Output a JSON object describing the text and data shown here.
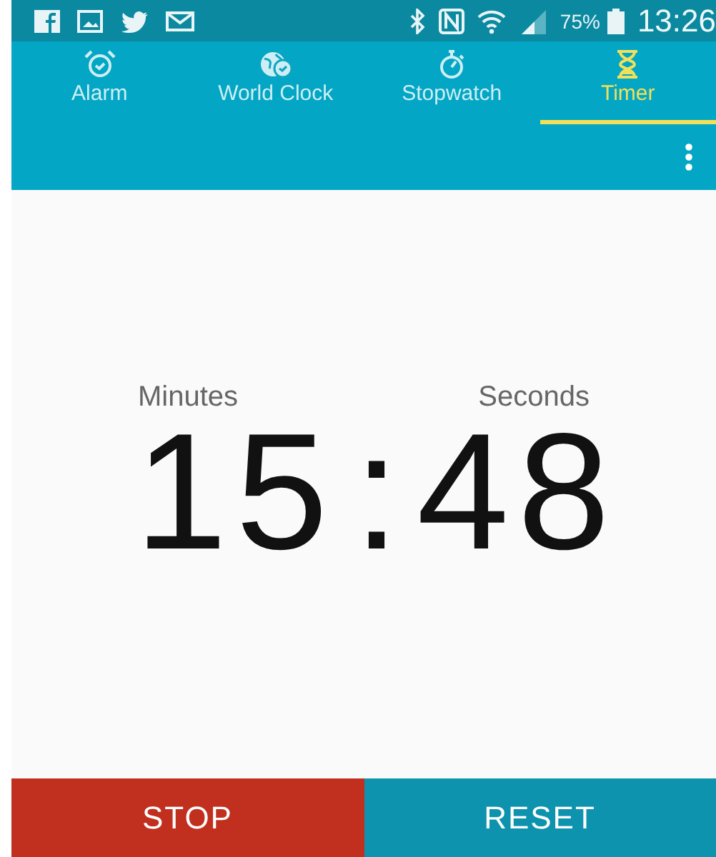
{
  "status_bar": {
    "battery": "75%",
    "time": "13:26"
  },
  "tabs": [
    {
      "label": "Alarm",
      "kind": "alarm",
      "selected": false
    },
    {
      "label": "World Clock",
      "kind": "globe",
      "selected": false
    },
    {
      "label": "Stopwatch",
      "kind": "stopwatch",
      "selected": false
    },
    {
      "label": "Timer",
      "kind": "hourglass",
      "selected": true
    }
  ],
  "timer": {
    "minutes_label": "Minutes",
    "seconds_label": "Seconds",
    "minutes": "15",
    "separator": ":",
    "seconds": "48"
  },
  "buttons": [
    {
      "label": "STOP",
      "kind": "stop"
    },
    {
      "label": "RESET",
      "kind": "reset"
    }
  ]
}
